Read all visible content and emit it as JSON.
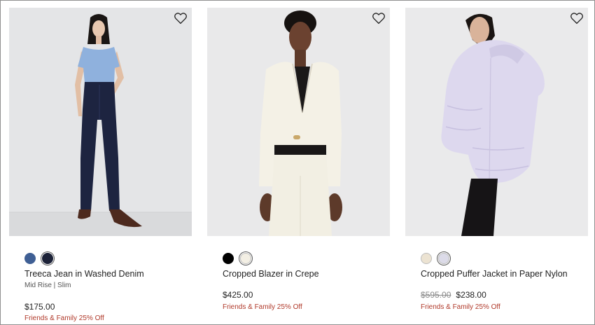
{
  "products": [
    {
      "name": "Treeca Jean in Washed Denim",
      "subtitle": "Mid Rise | Slim",
      "price": "$175.00",
      "original_price": "",
      "promo": "Friends & Family 25% Off",
      "swatches": [
        {
          "color": "#3f5f94",
          "selected": false
        },
        {
          "color": "#1c2238",
          "selected": true
        }
      ],
      "wishlist_icon": "heart-outline-icon"
    },
    {
      "name": "Cropped Blazer in Crepe",
      "subtitle": "",
      "price": "$425.00",
      "original_price": "",
      "promo": "Friends & Family 25% Off",
      "swatches": [
        {
          "color": "#000000",
          "selected": false
        },
        {
          "color": "#f3efe4",
          "selected": true
        }
      ],
      "wishlist_icon": "heart-outline-icon"
    },
    {
      "name": "Cropped Puffer Jacket in Paper Nylon",
      "subtitle": "",
      "price": "$238.00",
      "original_price": "$595.00",
      "promo": "Friends & Family 25% Off",
      "swatches": [
        {
          "color": "#ece3d2",
          "selected": false
        },
        {
          "color": "#dcdbe8",
          "selected": true
        }
      ],
      "wishlist_icon": "heart-outline-icon"
    }
  ]
}
